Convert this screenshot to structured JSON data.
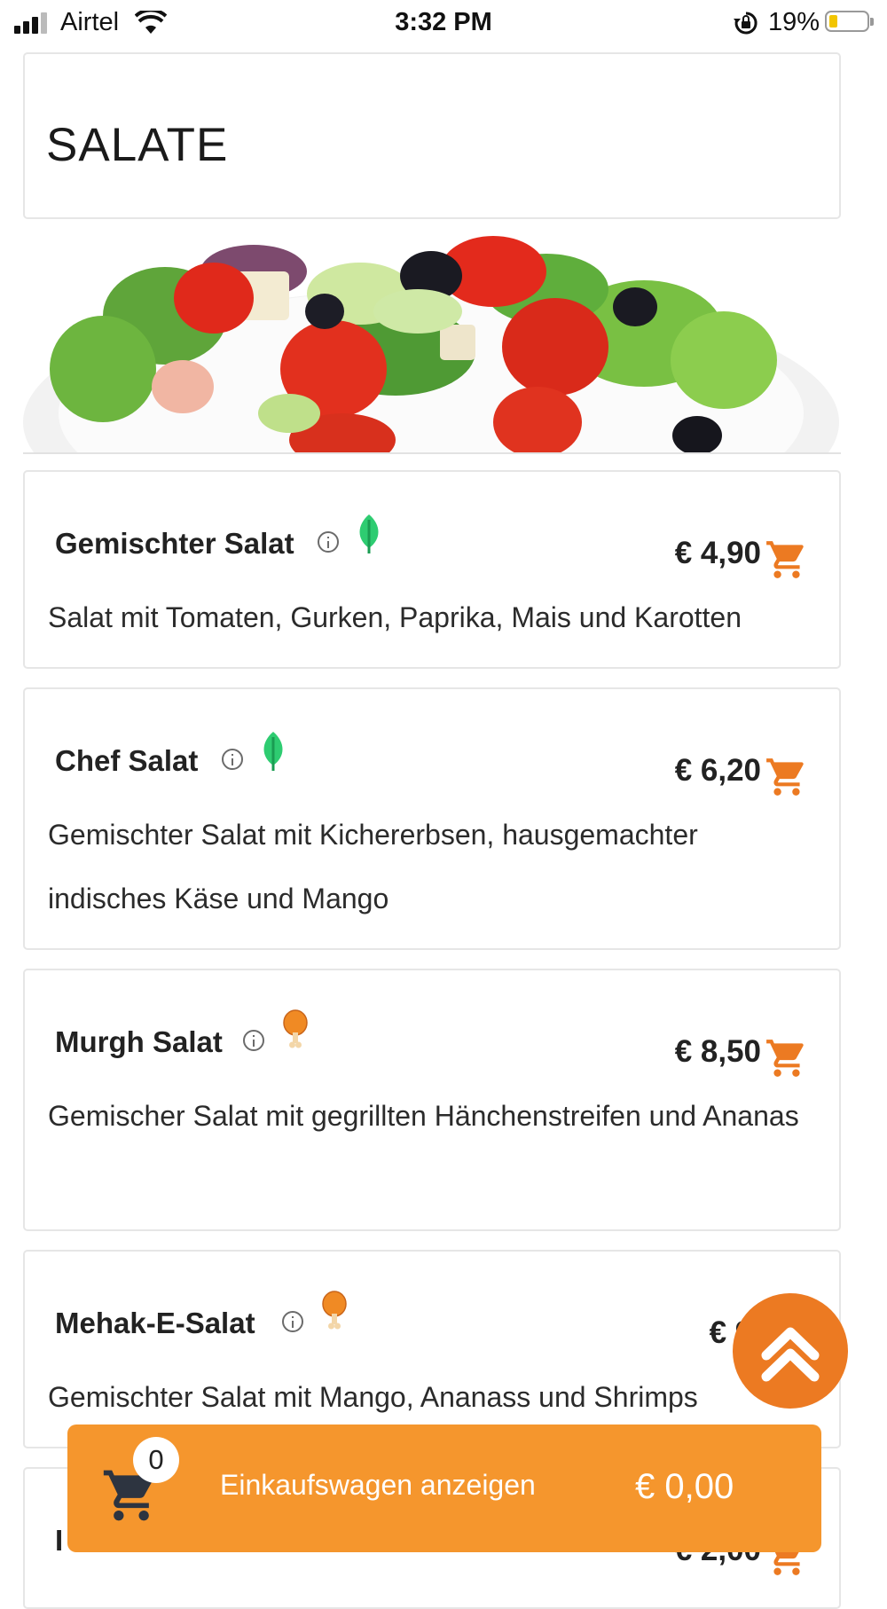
{
  "status_bar": {
    "carrier": "Airtel",
    "time": "3:32 PM",
    "battery_percent": "19%"
  },
  "category": {
    "title": "SALATE"
  },
  "hero_image": {
    "icon": "salad-photo"
  },
  "items": [
    {
      "name": "Gemischter Salat",
      "price": "€ 4,90",
      "description": "Salat mit Tomaten, Gurken, Paprika, Mais und Karotten",
      "diet_icon": "leaf-icon"
    },
    {
      "name": "Chef Salat",
      "price": "€ 6,20",
      "description": "Gemischter Salat mit Kichererbsen, hausgemachter indisches Käse und Mango",
      "diet_icon": "leaf-icon"
    },
    {
      "name": "Murgh Salat",
      "price": "€ 8,50",
      "description": "Gemischer Salat mit gegrillten Hänchenstreifen und Ananas",
      "diet_icon": "chicken-leg-icon"
    },
    {
      "name": "Mehak-E-Salat",
      "price": "€ 9,",
      "description": "Gemischter Salat mit Mango, Ananass und Shrimps",
      "diet_icon": "chicken-leg-icon"
    },
    {
      "name": "I",
      "price": "€ 2,00",
      "description": ""
    }
  ],
  "cart_bar": {
    "count": "0",
    "label": "Einkaufswagen anzeigen",
    "total": "€ 0,00"
  },
  "colors": {
    "accent_orange": "#ec7a22",
    "cart_bar": "#f5962d",
    "veg_green": "#2ecc71",
    "chicken_orange": "#f08a24"
  }
}
